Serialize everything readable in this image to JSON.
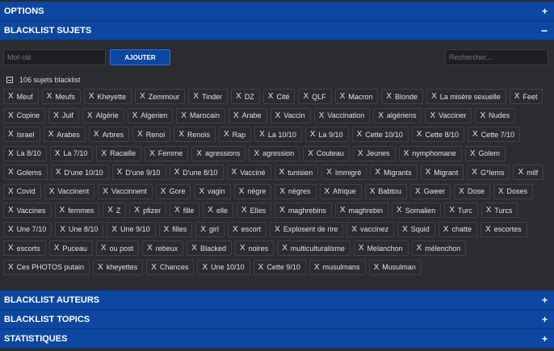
{
  "sections": {
    "options": {
      "title": "OPTIONS",
      "toggle": "+"
    },
    "blacklist_sujets": {
      "title": "BLACKLIST SUJETS",
      "toggle": "−"
    },
    "blacklist_auteurs": {
      "title": "BLACKLIST AUTEURS",
      "toggle": "+"
    },
    "blacklist_topics": {
      "title": "BLACKLIST TOPICS",
      "toggle": "+"
    },
    "statistiques": {
      "title": "STATISTIQUES",
      "toggle": "+"
    }
  },
  "controls": {
    "keyword_placeholder": "Mot-clé",
    "keyword_value": "",
    "add_label": "AJOUTER",
    "search_placeholder": "Rechercher...",
    "search_value": ""
  },
  "count_label": "106 sujets blacklist",
  "remove_glyph": "X",
  "tags": [
    "Meuf",
    "Meufs",
    "Kheyette",
    "Zemmour",
    "Tinder",
    "DZ",
    "Cité",
    "QLF",
    "Macron",
    "Blonde",
    "La misère sexuelle",
    "Feet",
    "Copine",
    "Juif",
    "Algérie",
    "Algerien",
    "Marocain",
    "Arabe",
    "Vaccin",
    "Vaccination",
    "algériens",
    "Vacciner",
    "Nudes",
    "Israel",
    "Arabes",
    "Arbres",
    "Renoi",
    "Renois",
    "Rap",
    "La 10/10",
    "La 9/10",
    "Cette 10/10",
    "Cette 8/10",
    "Cette 7/10",
    "La 8/10",
    "La 7/10",
    "Racaille",
    "Femme",
    "agressions",
    "agression",
    "Couteau",
    "Jeunes",
    "nymphomane",
    "Golem",
    "Golems",
    "D'une 10/10",
    "D'une 9/10",
    "D'une 8/10",
    "Vacciné",
    "tunisien",
    "Immigré",
    "Migrants",
    "Migrant",
    "G*lems",
    "milf",
    "Covid",
    "Vaccinent",
    "Vaccinnent",
    "Gore",
    "vagin",
    "nègre",
    "nègres",
    "Afrique",
    "Babtou",
    "Gweer",
    "Dose",
    "Doses",
    "Vaccines",
    "femmes",
    "Z",
    "pfizer",
    "fille",
    "elle",
    "Elles",
    "maghrebins",
    "maghrebin",
    "Somalien",
    "Turc",
    "Turcs",
    "Une 7/10",
    "Une 8/10",
    "Une 9/10",
    "filles",
    "girl",
    "escort",
    "Explosent de rire",
    "vaccinez",
    "Squid",
    "chatte",
    "escortes",
    "escorts",
    "Puceau",
    "ou post",
    "rebeux",
    "Blacked",
    "noires",
    "multiculturalisme",
    "Melanchon",
    "mélenchon",
    "Ces PHOTOS putain",
    "kheyettes",
    "Chances",
    "Une 10/10",
    "Cette 9/10",
    "musulmans",
    "Musulman"
  ]
}
